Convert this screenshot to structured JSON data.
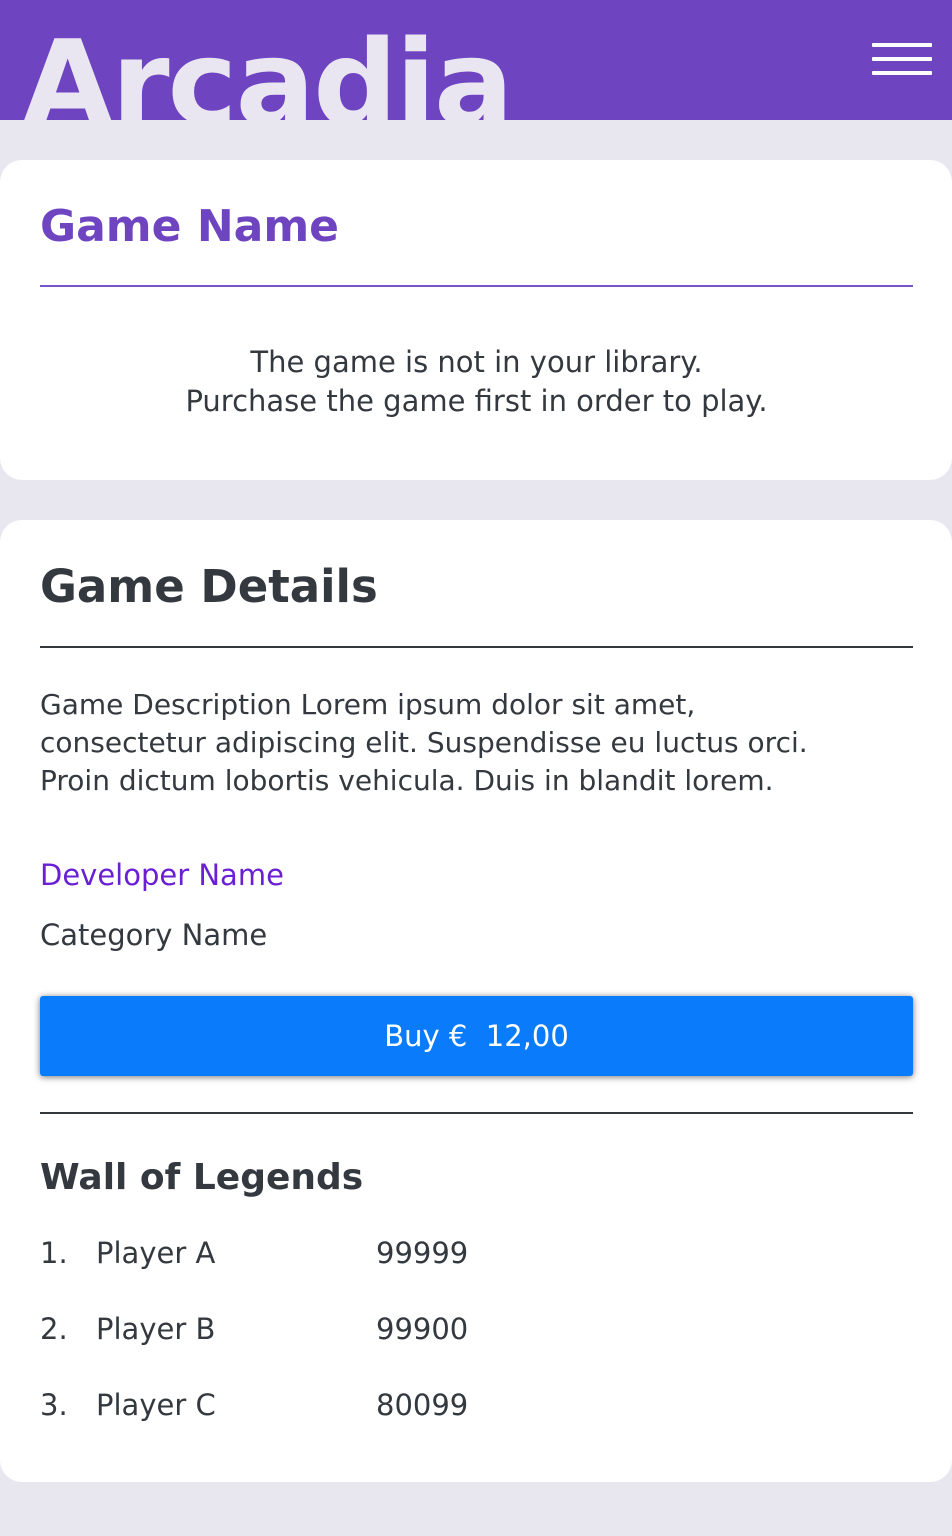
{
  "header": {
    "logo": "Arcadia",
    "menu_icon": "hamburger-menu-icon",
    "background_color": "#6e44c1"
  },
  "notice": {
    "title": "Game Name",
    "lines": [
      "The game is not in your library.",
      "Purchase the game first in order to play."
    ]
  },
  "details": {
    "title": "Game Details",
    "description_lines": [
      "Game Description Lorem ipsum dolor sit amet,",
      "consectetur adipiscing elit. Suspendisse eu luctus orci.",
      "Proin dictum lobortis vehicula. Duis in blandit lorem."
    ],
    "developer": "Developer Name",
    "category": "Category Name",
    "buy_label": "Buy €  12,00",
    "buy_color": "#0a7bfb"
  },
  "legends": {
    "title": "Wall of Legends",
    "rows": [
      {
        "rank": "1.",
        "player": "Player A",
        "score": "99999"
      },
      {
        "rank": "2.",
        "player": "Player B",
        "score": "99900"
      },
      {
        "rank": "3.",
        "player": "Player C",
        "score": "80099"
      }
    ]
  }
}
